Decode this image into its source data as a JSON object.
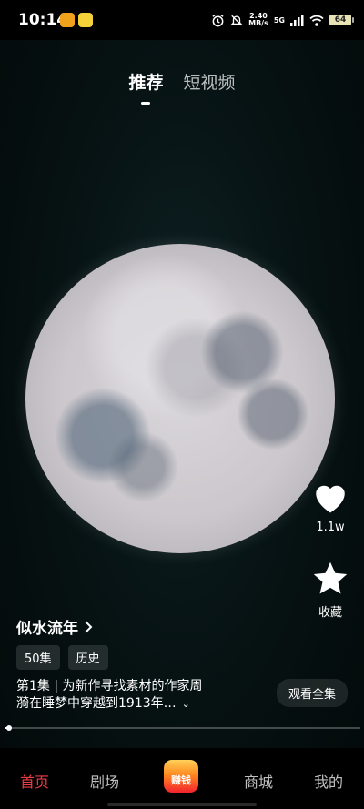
{
  "status_bar": {
    "time": "10:14",
    "net_speed_value": "2.40",
    "net_speed_unit": "MB/s",
    "network": "5G",
    "battery": "64",
    "icons": [
      "alarm-icon",
      "mute-bell-icon",
      "signal-icon",
      "wifi-icon",
      "battery-icon"
    ]
  },
  "top_tabs": [
    {
      "label": "推荐",
      "active": true
    },
    {
      "label": "短视频",
      "active": false
    }
  ],
  "actions": {
    "like_count": "1.1w",
    "favorite_label": "收藏"
  },
  "drama": {
    "title": "似水流年",
    "tags": [
      "50集",
      "历史"
    ],
    "description_line1": "第1集 | 为新作寻找素材的作家周",
    "description_line2": "漪在睡梦中穿越到1913年…",
    "watch_all": "观看全集",
    "progress": 0.01
  },
  "bottom_nav": {
    "items": [
      "首页",
      "剧场",
      "商城",
      "我的"
    ],
    "active": "首页",
    "earn_label": "赚钱"
  },
  "colors": {
    "accent": "#ef3b46",
    "background": "#071314"
  }
}
